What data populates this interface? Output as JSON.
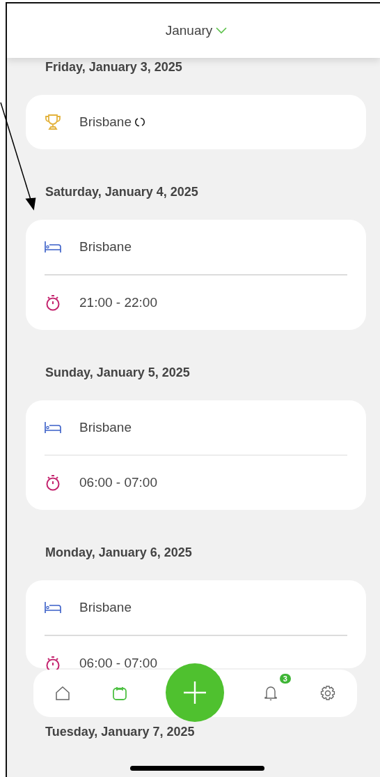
{
  "header": {
    "title": "January"
  },
  "days": [
    {
      "date": "Friday, January 3, 2025",
      "items": [
        {
          "kind": "trophy",
          "text": "Brisbane",
          "repeat": true
        }
      ]
    },
    {
      "date": "Saturday, January 4, 2025",
      "items": [
        {
          "kind": "bed",
          "text": "Brisbane",
          "repeat": false
        },
        {
          "kind": "timer",
          "text": "21:00 - 22:00",
          "repeat": false
        }
      ]
    },
    {
      "date": "Sunday, January 5, 2025",
      "items": [
        {
          "kind": "bed",
          "text": "Brisbane",
          "repeat": false
        },
        {
          "kind": "timer",
          "text": "06:00 - 07:00",
          "repeat": false
        }
      ]
    },
    {
      "date": "Monday, January 6, 2025",
      "items": [
        {
          "kind": "bed",
          "text": "Brisbane",
          "repeat": false
        },
        {
          "kind": "timer",
          "text": "06:00 - 07:00",
          "repeat": false
        }
      ]
    },
    {
      "date": "Tuesday, January 7, 2025"
    }
  ],
  "nav": {
    "items": [
      {
        "kind": "home",
        "selected": false
      },
      {
        "kind": "calendar",
        "selected": true
      },
      {
        "kind": "add",
        "selected": false
      },
      {
        "kind": "bell",
        "selected": false,
        "badge": "3"
      },
      {
        "kind": "settings",
        "selected": false
      }
    ]
  }
}
